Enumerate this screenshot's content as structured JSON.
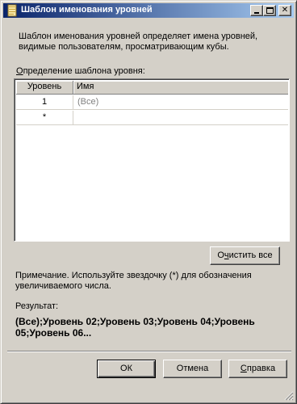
{
  "window": {
    "title": "Шаблон именования уровней",
    "minimize_icon": "minimize-icon",
    "maximize_icon": "maximize-icon",
    "close_label": "✕"
  },
  "description": "Шаблон именования уровней определяет имена уровней, видимые пользователям, просматривающим кубы.",
  "definition": {
    "label_first_char": "О",
    "label_rest": "пределение шаблона уровня:"
  },
  "grid": {
    "headers": {
      "level": "Уровень",
      "name": "Имя"
    },
    "rows": [
      {
        "level": "1",
        "name": "(Все)"
      },
      {
        "level": "*",
        "name": ""
      }
    ]
  },
  "buttons": {
    "clear_first": "О",
    "clear_ul": "ч",
    "clear_rest": "истить все",
    "ok": "ОК",
    "cancel": "Отмена",
    "help_ul": "С",
    "help_rest": "правка"
  },
  "note": "Примечание. Используйте звездочку (*) для обозначения увеличиваемого числа.",
  "result": {
    "label": "Результат:",
    "value": "(Все);Уровень 02;Уровень 03;Уровень 04;Уровень 05;Уровень 06..."
  },
  "colors": {
    "face": "#d4d0c8",
    "title_start": "#0a246a",
    "title_end": "#a6caf0"
  }
}
